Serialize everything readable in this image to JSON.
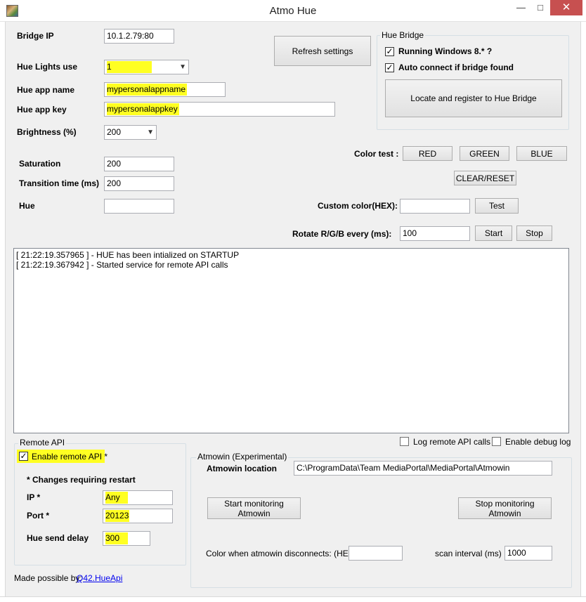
{
  "window": {
    "title": "Atmo Hue",
    "minimize": "—",
    "maximize": "□",
    "close": "✕",
    "icon": "app-icon"
  },
  "settings": {
    "bridge_ip_label": "Bridge IP",
    "bridge_ip_value": "10.1.2.79:80",
    "hue_lights_label": "Hue Lights use",
    "hue_lights_value": "1",
    "app_name_label": "Hue app name",
    "app_name_value": "mypersonalappname",
    "app_key_label": "Hue app key",
    "app_key_value": "mypersonalappkey",
    "brightness_label": "Brightness (%)",
    "brightness_value": "200",
    "saturation_label": "Saturation",
    "saturation_value": "200",
    "transition_label": "Transition time (ms)",
    "transition_value": "200",
    "hue_label": "Hue",
    "hue_value": "",
    "refresh_button": "Refresh settings"
  },
  "hue_bridge": {
    "group_title": "Hue Bridge",
    "running_windows_label": "Running Windows 8.* ?",
    "running_windows_checked": true,
    "auto_connect_label": "Auto connect if bridge found",
    "auto_connect_checked": true,
    "locate_button": "Locate and register to Hue Bridge"
  },
  "color_test": {
    "label": "Color test :",
    "red": "RED",
    "green": "GREEN",
    "blue": "BLUE",
    "clear": "CLEAR/RESET",
    "custom_label": "Custom color(HEX):",
    "custom_value": "",
    "test_button": "Test",
    "rotate_label": "Rotate R/G/B every (ms):",
    "rotate_value": "100",
    "start_button": "Start",
    "stop_button": "Stop"
  },
  "log": {
    "lines": [
      "[ 21:22:19.357965 ] - HUE has been intialized on STARTUP",
      "[ 21:22:19.367942 ] - Started service for remote API calls"
    ],
    "log_remote_label": "Log remote API calls",
    "debug_label": "Enable debug log"
  },
  "remote_api": {
    "group_title": "Remote API",
    "enable_label": "Enable remote API *",
    "enable_checked": true,
    "changes_note": "* Changes requiring restart",
    "ip_label": "IP *",
    "ip_value": "Any",
    "port_label": "Port *",
    "port_value": "20123",
    "send_delay_label": "Hue send delay",
    "send_delay_value": "300"
  },
  "atmowin": {
    "group_title": "Atmowin (Experimental)",
    "location_label": "Atmowin location",
    "location_value": "C:\\ProgramData\\Team MediaPortal\\MediaPortal\\Atmowin",
    "start_button": "Start monitoring Atmowin",
    "stop_button": "Stop monitoring Atmowin",
    "disconnect_label": "Color when atmowin disconnects: (HEX):",
    "disconnect_value": "",
    "scan_label": "scan interval (ms)",
    "scan_value": "1000"
  },
  "footer": {
    "made_by": "Made possible by:",
    "link": "Q42.HueApi"
  },
  "colors": {
    "highlight": "#ffff22",
    "close_button": "#c75050",
    "link": "#0000ee"
  }
}
